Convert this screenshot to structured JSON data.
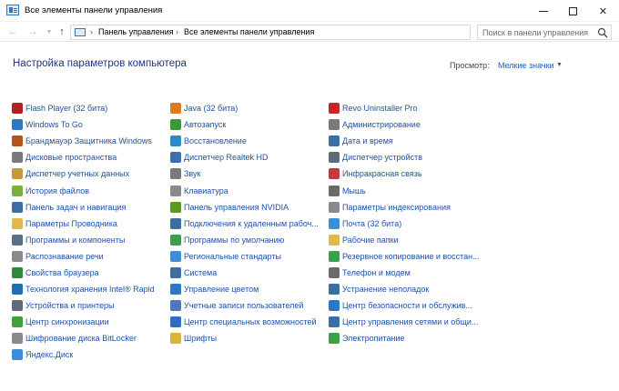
{
  "window": {
    "title": "Все элементы панели управления"
  },
  "nav": {
    "breadcrumbs": [
      "Панель управления",
      "Все элементы панели управления"
    ],
    "search_placeholder": "Поиск в панели управления"
  },
  "header": {
    "title": "Настройка параметров компьютера",
    "view_label": "Просмотр:",
    "view_value": "Мелкие значки"
  },
  "columns": [
    [
      {
        "label": "Flash Player (32 бита)",
        "icon": "flash-icon",
        "color": "#b32020"
      },
      {
        "label": "Windows To Go",
        "icon": "windows-to-go-icon",
        "color": "#2b78c5"
      },
      {
        "label": "Брандмауэр Защитника Windows",
        "icon": "firewall-icon",
        "color": "#b5531a"
      },
      {
        "label": "Дисковые пространства",
        "icon": "storage-spaces-icon",
        "color": "#7a7a7a"
      },
      {
        "label": "Диспетчер учетных данных",
        "icon": "credential-manager-icon",
        "color": "#c29a3b"
      },
      {
        "label": "История файлов",
        "icon": "file-history-icon",
        "color": "#7bb03a"
      },
      {
        "label": "Панель задач и навигация",
        "icon": "taskbar-icon",
        "color": "#3a6ea5"
      },
      {
        "label": "Параметры Проводника",
        "icon": "explorer-options-icon",
        "color": "#e2b84b"
      },
      {
        "label": "Программы и компоненты",
        "icon": "programs-icon",
        "color": "#5a6f87"
      },
      {
        "label": "Распознавание речи",
        "icon": "microphone-icon",
        "color": "#8a8a8a"
      },
      {
        "label": "Свойства браузера",
        "icon": "internet-options-icon",
        "color": "#2f8a3b"
      },
      {
        "label": "Технология хранения Intel® Rapid",
        "icon": "intel-rst-icon",
        "color": "#1f6db3"
      },
      {
        "label": "Устройства и принтеры",
        "icon": "devices-printers-icon",
        "color": "#5f6b78"
      },
      {
        "label": "Центр синхронизации",
        "icon": "sync-center-icon",
        "color": "#3ea13b"
      },
      {
        "label": "Шифрование диска BitLocker",
        "icon": "bitlocker-icon",
        "color": "#8a8a8a"
      },
      {
        "label": "Яндекс.Диск",
        "icon": "yandex-disk-icon",
        "color": "#3a8fd8"
      }
    ],
    [
      {
        "label": "Java (32 бита)",
        "icon": "java-icon",
        "color": "#e07a1f"
      },
      {
        "label": "Автозапуск",
        "icon": "autoplay-icon",
        "color": "#3a9a3a"
      },
      {
        "label": "Восстановление",
        "icon": "recovery-icon",
        "color": "#2a8bc9"
      },
      {
        "label": "Диспетчер Realtek HD",
        "icon": "realtek-icon",
        "color": "#3b6fb0"
      },
      {
        "label": "Звук",
        "icon": "sound-icon",
        "color": "#7a7a7a"
      },
      {
        "label": "Клавиатура",
        "icon": "keyboard-icon",
        "color": "#8a8a8a"
      },
      {
        "label": "Панель управления NVIDIA",
        "icon": "nvidia-icon",
        "color": "#5a9a1a"
      },
      {
        "label": "Подключения к удаленным рабоч...",
        "icon": "remote-desktop-icon",
        "color": "#3a6ea5"
      },
      {
        "label": "Программы по умолчанию",
        "icon": "default-programs-icon",
        "color": "#3aa14a"
      },
      {
        "label": "Региональные стандарты",
        "icon": "region-icon",
        "color": "#3a8fd8"
      },
      {
        "label": "Система",
        "icon": "system-icon",
        "color": "#3a6ea5"
      },
      {
        "label": "Управление цветом",
        "icon": "color-management-icon",
        "color": "#2b78c5"
      },
      {
        "label": "Учетные записи пользователей",
        "icon": "user-accounts-icon",
        "color": "#4a7ab8"
      },
      {
        "label": "Центр специальных возможностей",
        "icon": "ease-of-access-icon",
        "color": "#2b6fc5"
      },
      {
        "label": "Шрифты",
        "icon": "fonts-icon",
        "color": "#d9b23a"
      }
    ],
    [
      {
        "label": "Revo Uninstaller Pro",
        "icon": "revo-uninstaller-icon",
        "color": "#c22828"
      },
      {
        "label": "Администрирование",
        "icon": "admin-tools-icon",
        "color": "#7a7a7a"
      },
      {
        "label": "Дата и время",
        "icon": "date-time-icon",
        "color": "#3a6ea5"
      },
      {
        "label": "Диспетчер устройств",
        "icon": "device-manager-icon",
        "color": "#5f6b78"
      },
      {
        "label": "Инфракрасная связь",
        "icon": "infrared-icon",
        "color": "#c23a3a"
      },
      {
        "label": "Мышь",
        "icon": "mouse-icon",
        "color": "#6a6a6a"
      },
      {
        "label": "Параметры индексирования",
        "icon": "indexing-icon",
        "color": "#8a8a8a"
      },
      {
        "label": "Почта (32 бита)",
        "icon": "mail-icon",
        "color": "#3a8fd8"
      },
      {
        "label": "Рабочие папки",
        "icon": "work-folders-icon",
        "color": "#e2b84b"
      },
      {
        "label": "Резервное копирование и восстан...",
        "icon": "backup-icon",
        "color": "#3aa14a"
      },
      {
        "label": "Телефон и модем",
        "icon": "phone-modem-icon",
        "color": "#6a6a6a"
      },
      {
        "label": "Устранение неполадок",
        "icon": "troubleshooting-icon",
        "color": "#3a6ea5"
      },
      {
        "label": "Центр безопасности и обслужив...",
        "icon": "security-flag-icon",
        "color": "#2b78c5"
      },
      {
        "label": "Центр управления сетями и общи...",
        "icon": "network-center-icon",
        "color": "#3a6ea5"
      },
      {
        "label": "Электропитание",
        "icon": "power-options-icon",
        "color": "#3aa14a"
      }
    ]
  ]
}
